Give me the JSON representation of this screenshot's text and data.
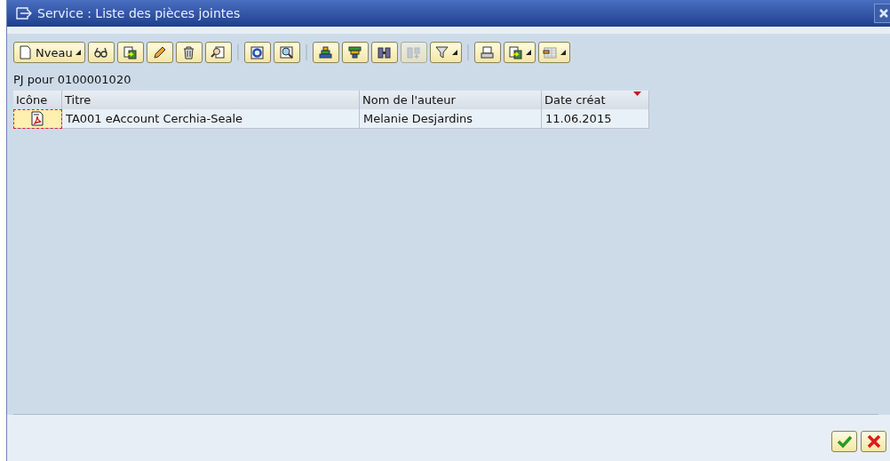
{
  "window": {
    "title": "Service : Liste des pièces jointes"
  },
  "toolbar": [
    {
      "kind": "button",
      "label": "Nveau",
      "menu": true,
      "disabled": false
    },
    {
      "kind": "button",
      "menu": false,
      "disabled": false
    },
    {
      "kind": "button",
      "menu": false,
      "disabled": false
    },
    {
      "kind": "button",
      "menu": false,
      "disabled": false
    },
    {
      "kind": "button",
      "menu": false,
      "disabled": false
    },
    {
      "kind": "button",
      "menu": false,
      "disabled": false
    },
    {
      "kind": "separator"
    },
    {
      "kind": "button",
      "menu": false,
      "disabled": false
    },
    {
      "kind": "button",
      "menu": false,
      "disabled": false
    },
    {
      "kind": "separator"
    },
    {
      "kind": "button",
      "menu": false,
      "disabled": false
    },
    {
      "kind": "button",
      "menu": false,
      "disabled": false
    },
    {
      "kind": "button",
      "menu": false,
      "disabled": false
    },
    {
      "kind": "button",
      "menu": false,
      "disabled": true
    },
    {
      "kind": "button",
      "menu": true,
      "disabled": false
    },
    {
      "kind": "separator"
    },
    {
      "kind": "button",
      "menu": false,
      "disabled": false
    },
    {
      "kind": "button",
      "menu": true,
      "disabled": false
    },
    {
      "kind": "button",
      "menu": true,
      "disabled": false
    }
  ],
  "caption": "PJ pour 0100001020",
  "table": {
    "columns": [
      {
        "label": "Icône",
        "sorted": false
      },
      {
        "label": "Titre",
        "sorted": false
      },
      {
        "label": "Nom de l'auteur",
        "sorted": false
      },
      {
        "label": "Date créat",
        "sorted": true
      }
    ],
    "rows": [
      {
        "selected": true,
        "title": "TA001 eAccount Cerchia-Seale",
        "author": "Melanie Desjardins",
        "date": "11.06.2015"
      }
    ]
  }
}
